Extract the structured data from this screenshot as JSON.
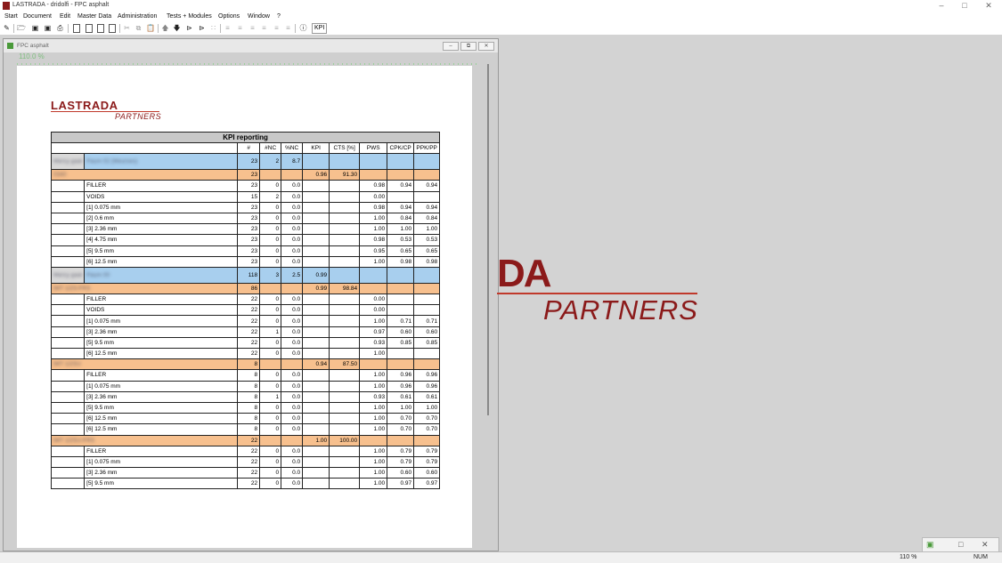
{
  "app": {
    "title": "LASTRADA - dridolfi - FPC asphalt"
  },
  "menu": [
    "Start",
    "Document",
    "Edit",
    "Master Data",
    "Administration",
    "Tests + Modules",
    "Options",
    "Window",
    "?"
  ],
  "toolbar": {
    "kpi_label": "KPI"
  },
  "child": {
    "title": "FPC asphalt",
    "zoom": "110.0 %"
  },
  "logo": {
    "brand": "LASTRADA",
    "sub": "PARTNERS"
  },
  "big_logo": {
    "brand": "DA",
    "sub": "PARTNERS"
  },
  "report": {
    "caption": "KPI reporting",
    "columns": [
      "#",
      "#NC",
      "%NC",
      "KPI",
      "CTS [%]",
      "PWS",
      "CPK/CP",
      "PPK/PP"
    ],
    "rows": [
      {
        "kind": "blue",
        "sub": "Mercy gaat",
        "name": "Paum 02 (Meurses)",
        "n": "23",
        "nc": "2",
        "pnc": "8.7",
        "kpi": "",
        "cts": "",
        "pws": "",
        "cpk": "",
        "ppk": ""
      },
      {
        "kind": "orange",
        "name": "0340",
        "n": "23",
        "nc": "",
        "pnc": "",
        "kpi": "0.96",
        "cts": "91.30",
        "pws": "",
        "cpk": "",
        "ppk": ""
      },
      {
        "kind": "item",
        "name": "FILLER",
        "n": "23",
        "nc": "0",
        "pnc": "0.0",
        "kpi": "",
        "cts": "",
        "pws": "0.98",
        "cpk": "0.94",
        "ppk": "0.94"
      },
      {
        "kind": "item",
        "name": "VOIDS",
        "n": "15",
        "nc": "2",
        "pnc": "0.0",
        "kpi": "",
        "cts": "",
        "pws": "0.00",
        "cpk": "",
        "ppk": ""
      },
      {
        "kind": "item",
        "name": "[1] 0.075 mm",
        "n": "23",
        "nc": "0",
        "pnc": "0.0",
        "kpi": "",
        "cts": "",
        "pws": "0.98",
        "cpk": "0.94",
        "ppk": "0.94"
      },
      {
        "kind": "item",
        "name": "[2] 0.6 mm",
        "n": "23",
        "nc": "0",
        "pnc": "0.0",
        "kpi": "",
        "cts": "",
        "pws": "1.00",
        "cpk": "0.84",
        "ppk": "0.84"
      },
      {
        "kind": "item",
        "name": "[3] 2.36 mm",
        "n": "23",
        "nc": "0",
        "pnc": "0.0",
        "kpi": "",
        "cts": "",
        "pws": "1.00",
        "cpk": "1.00",
        "ppk": "1.00"
      },
      {
        "kind": "item",
        "name": "[4] 4.75 mm",
        "n": "23",
        "nc": "0",
        "pnc": "0.0",
        "kpi": "",
        "cts": "",
        "pws": "0.98",
        "cpk": "0.53",
        "ppk": "0.53"
      },
      {
        "kind": "item",
        "name": "[5] 9.5 mm",
        "n": "23",
        "nc": "0",
        "pnc": "0.0",
        "kpi": "",
        "cts": "",
        "pws": "0.95",
        "cpk": "0.65",
        "ppk": "0.65"
      },
      {
        "kind": "item",
        "name": "[6] 12.5 mm",
        "n": "23",
        "nc": "0",
        "pnc": "0.0",
        "kpi": "",
        "cts": "",
        "pws": "1.00",
        "cpk": "0.98",
        "ppk": "0.98"
      },
      {
        "kind": "blue",
        "sub": "Mercy gaat",
        "name": "Paum 00",
        "n": "118",
        "nc": "3",
        "pnc": "2.5",
        "kpi": "0.99",
        "cts": "",
        "pws": "",
        "cpk": "",
        "ppk": ""
      },
      {
        "kind": "orange",
        "name": "IMT 1/2S-FRS",
        "n": "86",
        "nc": "",
        "pnc": "",
        "kpi": "0.99",
        "cts": "98.84",
        "pws": "",
        "cpk": "",
        "ppk": ""
      },
      {
        "kind": "item",
        "name": "FILLER",
        "n": "22",
        "nc": "0",
        "pnc": "0.0",
        "kpi": "",
        "cts": "",
        "pws": "0.00",
        "cpk": "",
        "ppk": ""
      },
      {
        "kind": "item",
        "name": "VOIDS",
        "n": "22",
        "nc": "0",
        "pnc": "0.0",
        "kpi": "",
        "cts": "",
        "pws": "0.00",
        "cpk": "",
        "ppk": ""
      },
      {
        "kind": "item",
        "name": "[1] 0.075 mm",
        "n": "22",
        "nc": "0",
        "pnc": "0.0",
        "kpi": "",
        "cts": "",
        "pws": "1.00",
        "cpk": "0.71",
        "ppk": "0.71"
      },
      {
        "kind": "item",
        "name": "[3] 2.36 mm",
        "n": "22",
        "nc": "1",
        "pnc": "0.0",
        "kpi": "",
        "cts": "",
        "pws": "0.97",
        "cpk": "0.60",
        "ppk": "0.60"
      },
      {
        "kind": "item",
        "name": "[5] 9.5 mm",
        "n": "22",
        "nc": "0",
        "pnc": "0.0",
        "kpi": "",
        "cts": "",
        "pws": "0.93",
        "cpk": "0.85",
        "ppk": "0.85"
      },
      {
        "kind": "item",
        "name": "[6] 12.5 mm",
        "n": "22",
        "nc": "0",
        "pnc": "0.0",
        "kpi": "",
        "cts": "",
        "pws": "1.00",
        "cpk": "",
        "ppk": ""
      },
      {
        "kind": "orange",
        "name": "IMT 1/2SU",
        "n": "8",
        "nc": "",
        "pnc": "",
        "kpi": "0.94",
        "cts": "87.50",
        "pws": "",
        "cpk": "",
        "ppk": ""
      },
      {
        "kind": "item",
        "name": "FILLER",
        "n": "8",
        "nc": "0",
        "pnc": "0.0",
        "kpi": "",
        "cts": "",
        "pws": "1.00",
        "cpk": "0.96",
        "ppk": "0.96"
      },
      {
        "kind": "item",
        "name": "[1] 0.075 mm",
        "n": "8",
        "nc": "0",
        "pnc": "0.0",
        "kpi": "",
        "cts": "",
        "pws": "1.00",
        "cpk": "0.96",
        "ppk": "0.96"
      },
      {
        "kind": "item",
        "name": "[3] 2.36 mm",
        "n": "8",
        "nc": "1",
        "pnc": "0.0",
        "kpi": "",
        "cts": "",
        "pws": "0.93",
        "cpk": "0.61",
        "ppk": "0.61"
      },
      {
        "kind": "item",
        "name": "[5] 9.5 mm",
        "n": "8",
        "nc": "0",
        "pnc": "0.0",
        "kpi": "",
        "cts": "",
        "pws": "1.00",
        "cpk": "1.00",
        "ppk": "1.00"
      },
      {
        "kind": "item",
        "name": "[6] 12.5 mm",
        "n": "8",
        "nc": "0",
        "pnc": "0.0",
        "kpi": "",
        "cts": "",
        "pws": "1.00",
        "cpk": "0.70",
        "ppk": "0.70"
      },
      {
        "kind": "item",
        "name": "[6] 12.5 mm",
        "n": "8",
        "nc": "0",
        "pnc": "0.0",
        "kpi": "",
        "cts": "",
        "pws": "1.00",
        "cpk": "0.70",
        "ppk": "0.70"
      },
      {
        "kind": "orange",
        "name": "IMT 1/2SU-FRS",
        "n": "22",
        "nc": "",
        "pnc": "",
        "kpi": "1.00",
        "cts": "100.00",
        "pws": "",
        "cpk": "",
        "ppk": ""
      },
      {
        "kind": "item",
        "name": "FILLER",
        "n": "22",
        "nc": "0",
        "pnc": "0.0",
        "kpi": "",
        "cts": "",
        "pws": "1.00",
        "cpk": "0.79",
        "ppk": "0.79"
      },
      {
        "kind": "item",
        "name": "[1] 0.075 mm",
        "n": "22",
        "nc": "0",
        "pnc": "0.0",
        "kpi": "",
        "cts": "",
        "pws": "1.00",
        "cpk": "0.79",
        "ppk": "0.79"
      },
      {
        "kind": "item",
        "name": "[3] 2.36 mm",
        "n": "22",
        "nc": "0",
        "pnc": "0.0",
        "kpi": "",
        "cts": "",
        "pws": "1.00",
        "cpk": "0.60",
        "ppk": "0.60"
      },
      {
        "kind": "item",
        "name": "[5] 9.5 mm",
        "n": "22",
        "nc": "0",
        "pnc": "0.0",
        "kpi": "",
        "cts": "",
        "pws": "1.00",
        "cpk": "0.97",
        "ppk": "0.97"
      }
    ]
  },
  "status": {
    "zoom": "110 %",
    "num": "NUM"
  },
  "colors": {
    "brand": "#8b1a1a",
    "group_blue": "#a8cfee",
    "group_orange": "#f7c08e",
    "workspace": "#d3d3d3"
  }
}
